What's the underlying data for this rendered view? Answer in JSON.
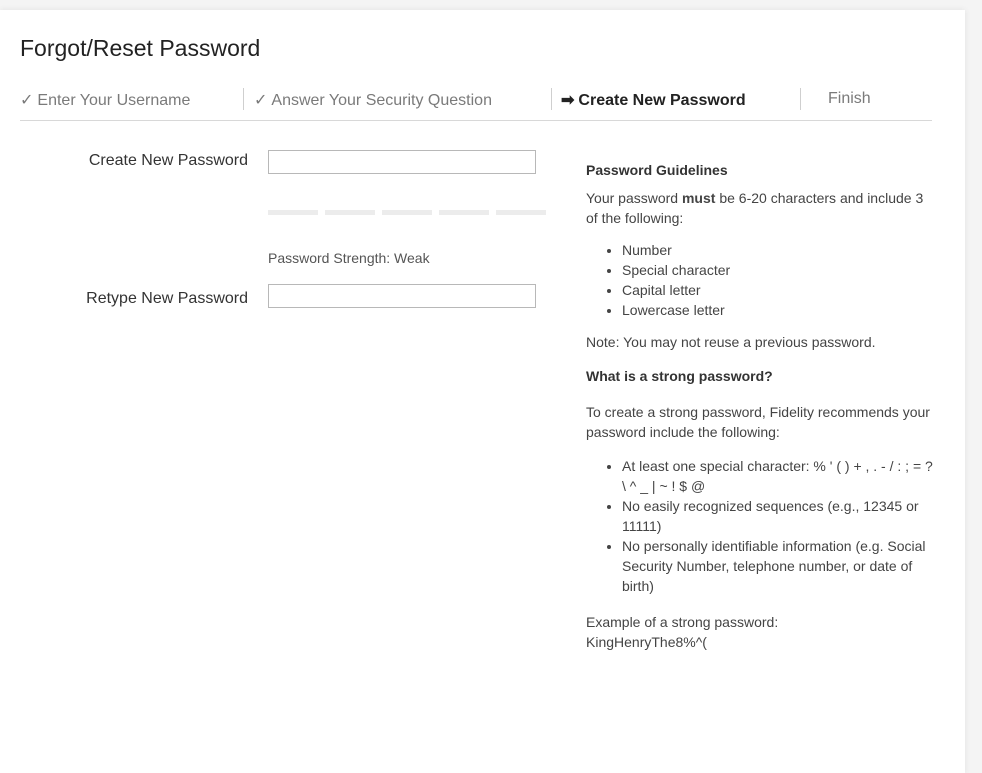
{
  "page": {
    "title": "Forgot/Reset Password"
  },
  "steps": [
    {
      "mark": "✓",
      "label": "Enter Your Username",
      "state": "done"
    },
    {
      "mark": "✓",
      "label": "Answer Your Security Question",
      "state": "done"
    },
    {
      "mark": "➡",
      "label": "Create New Password",
      "state": "active"
    },
    {
      "mark": "",
      "label": "Finish",
      "state": "pending"
    }
  ],
  "form": {
    "new_password_label": "Create New Password",
    "new_password_value": "",
    "strength_text": "Password Strength: Weak",
    "strength_level": 0,
    "retype_label": "Retype New Password",
    "retype_value": ""
  },
  "guidelines": {
    "heading": "Password Guidelines",
    "intro_pre": "Your password ",
    "intro_bold": "must",
    "intro_post": " be 6-20 characters and include 3 of the following:",
    "requirements": [
      "Number",
      "Special character",
      "Capital letter",
      "Lowercase letter"
    ],
    "note": "Note: You may not reuse a previous password.",
    "strong_heading": "What is a strong password?",
    "strong_intro": "To create a strong password, Fidelity recommends your password include the following:",
    "strong_items": [
      "At least one special character: % ' ( ) + , . - / : ; = ? \\ ^ _ | ~ ! $ @",
      "No easily recognized sequences (e.g., 12345 or 11111)",
      "No personally identifiable information (e.g. Social Security Number, telephone number, or date of birth)"
    ],
    "example_label": "Example of a strong password:",
    "example_value": "KingHenryThe8%^("
  },
  "colors": {
    "active_step": "#222222",
    "inactive_step": "#7a7a7a",
    "meter_empty": "#ececec"
  }
}
